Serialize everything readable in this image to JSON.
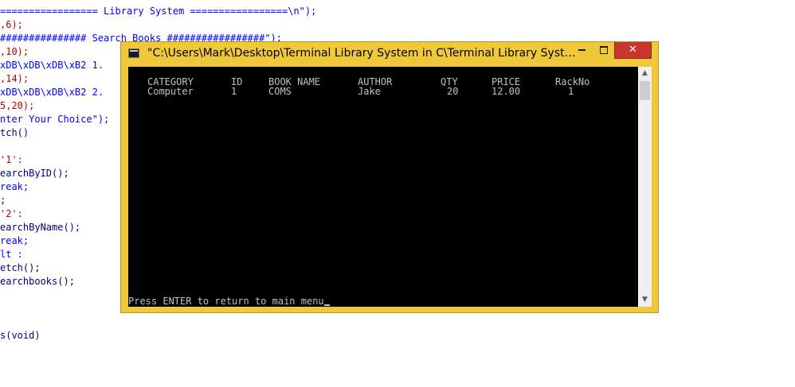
{
  "editor": {
    "lines": [
      {
        "segments": [
          {
            "t": "================= Library System =================\\n\");",
            "c": "c-blue"
          }
        ]
      },
      {
        "segments": [
          {
            "t": ",6);",
            "c": "c-red"
          }
        ]
      },
      {
        "segments": [
          {
            "t": "############### Search Books #################\");",
            "c": "c-blue"
          }
        ]
      },
      {
        "segments": [
          {
            "t": ",10);",
            "c": "c-red"
          }
        ]
      },
      {
        "segments": [
          {
            "t": "xDB\\xDB\\xDB\\xB2 1.",
            "c": "c-blue"
          }
        ]
      },
      {
        "segments": [
          {
            "t": ",14);",
            "c": "c-red"
          }
        ]
      },
      {
        "segments": [
          {
            "t": "xDB\\xDB\\xDB\\xB2 2.",
            "c": "c-blue"
          }
        ]
      },
      {
        "segments": [
          {
            "t": "5,20);",
            "c": "c-red"
          }
        ]
      },
      {
        "segments": [
          {
            "t": "nter Your Choice\");",
            "c": "c-blue"
          }
        ]
      },
      {
        "segments": [
          {
            "t": "tch()",
            "c": "c-navy"
          }
        ]
      },
      {
        "segments": [
          {
            "t": "",
            "c": "c-navy"
          }
        ]
      },
      {
        "segments": [
          {
            "t": "'1':",
            "c": "c-red"
          }
        ]
      },
      {
        "segments": [
          {
            "t": "earchByID();",
            "c": "c-navy"
          }
        ]
      },
      {
        "segments": [
          {
            "t": "reak;",
            "c": "c-blue"
          }
        ]
      },
      {
        "segments": [
          {
            "t": ";",
            "c": "c-navy"
          }
        ]
      },
      {
        "segments": [
          {
            "t": "'2':",
            "c": "c-red"
          }
        ]
      },
      {
        "segments": [
          {
            "t": "earchByName();",
            "c": "c-navy"
          }
        ]
      },
      {
        "segments": [
          {
            "t": "reak;",
            "c": "c-blue"
          }
        ]
      },
      {
        "segments": [
          {
            "t": "lt :",
            "c": "c-blue"
          }
        ]
      },
      {
        "segments": [
          {
            "t": "etch();",
            "c": "c-navy"
          }
        ]
      },
      {
        "segments": [
          {
            "t": "earchbooks();",
            "c": "c-navy"
          }
        ]
      },
      {
        "segments": [
          {
            "t": "",
            "c": "c-navy"
          }
        ]
      },
      {
        "segments": [
          {
            "t": "",
            "c": "c-navy"
          }
        ]
      },
      {
        "segments": [
          {
            "t": "",
            "c": "c-navy"
          }
        ]
      },
      {
        "segments": [
          {
            "t": "s(void)",
            "c": "c-navy"
          }
        ]
      }
    ]
  },
  "window": {
    "title": "\"C:\\Users\\Mark\\Desktop\\Terminal Library System in C\\Terminal Library System....",
    "minimize_label": "",
    "maximize_label": "",
    "close_label": "✕",
    "accent_color": "#f0c93b",
    "close_color": "#c7372f"
  },
  "console": {
    "headers": [
      "CATEGORY",
      "ID",
      "BOOK NAME",
      "AUTHOR",
      "QTY",
      "PRICE",
      "RackNo"
    ],
    "rows": [
      [
        "Computer",
        "1",
        "COMS",
        "Jake",
        "20",
        "12.00",
        "1"
      ]
    ],
    "prompt": "Press ENTER to return to main menu"
  },
  "scrollbar": {
    "up_icon": "▲",
    "down_icon": "▼"
  }
}
